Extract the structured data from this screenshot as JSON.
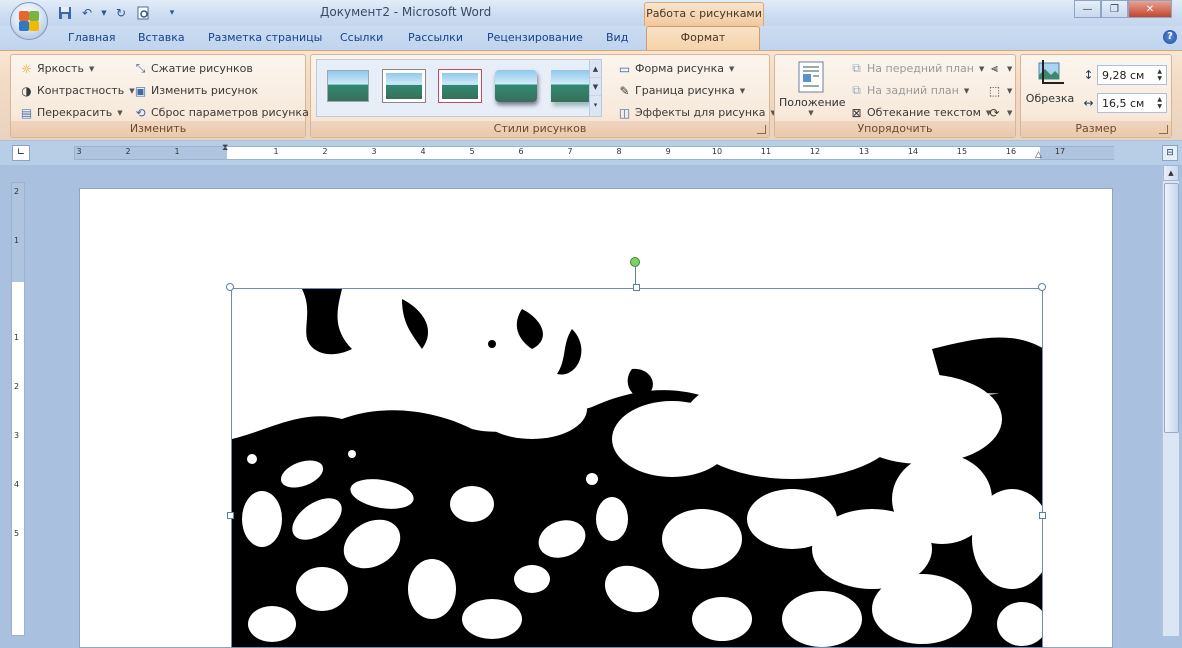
{
  "window": {
    "title": "Документ2 - Microsoft Word",
    "context_tab_header": "Работа с рисунками"
  },
  "tabs": [
    "Главная",
    "Вставка",
    "Разметка страницы",
    "Ссылки",
    "Рассылки",
    "Рецензирование",
    "Вид"
  ],
  "active_tab": "Формат",
  "groups": {
    "adjust": {
      "label": "Изменить",
      "brightness": "Яркость",
      "contrast": "Контрастность",
      "recolor": "Перекрасить",
      "compress": "Сжатие рисунков",
      "change": "Изменить рисунок",
      "reset": "Сброс параметров рисунка"
    },
    "styles": {
      "label": "Стили рисунков",
      "shape": "Форма рисунка",
      "border": "Граница рисунка",
      "effects": "Эффекты для рисунка"
    },
    "arrange": {
      "label": "Упорядочить",
      "position": "Положение",
      "bring_front": "На передний план",
      "send_back": "На задний план",
      "text_wrap": "Обтекание текстом"
    },
    "size": {
      "label": "Размер",
      "crop": "Обрезка",
      "height": "9,28 см",
      "width": "16,5 см"
    }
  },
  "ruler": {
    "left_numbers": [
      "3",
      "2",
      "1"
    ],
    "numbers": [
      "1",
      "2",
      "3",
      "4",
      "5",
      "6",
      "7",
      "8",
      "9",
      "10",
      "11",
      "12",
      "13",
      "14",
      "15",
      "16",
      "17"
    ],
    "vertical_numbers": [
      "2",
      "1",
      "1",
      "2",
      "3",
      "4",
      "5"
    ]
  },
  "colors": {
    "accent_contextual": "#f5d3ab",
    "ribbon_blue": "#c0d4ee",
    "close_button": "#c2462e"
  }
}
